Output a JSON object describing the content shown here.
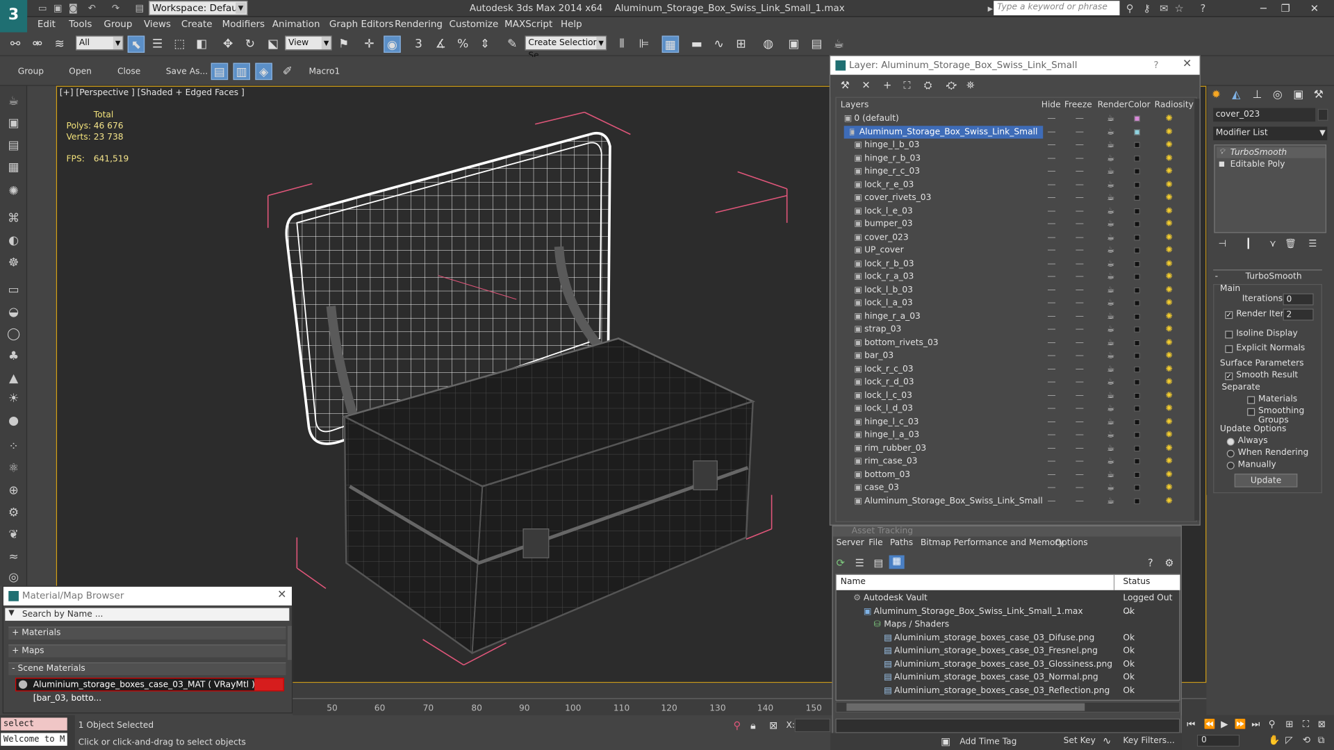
{
  "title": {
    "app": "Autodesk 3ds Max  2014 x64",
    "file": "Aluminum_Storage_Box_Swiss_Link_Small_1.max",
    "workspace": "Workspace: Default",
    "search_placeholder": "Type a keyword or phrase"
  },
  "menu": [
    "Edit",
    "Tools",
    "Group",
    "Views",
    "Create",
    "Modifiers",
    "Animation",
    "Graph Editors",
    "Rendering",
    "Customize",
    "MAXScript",
    "Help"
  ],
  "toolbar": {
    "selection_filter": "All",
    "ref_coord": "View",
    "named_selection": "Create Selection Se",
    "group_labels": [
      "Group",
      "Open",
      "Close",
      "Save As...",
      "Macro1"
    ]
  },
  "viewport": {
    "label": "[+] [Perspective ] [Shaded + Edged Faces ]",
    "stats_header": "Total",
    "polys_label": "Polys:",
    "polys": "46 676",
    "verts_label": "Verts:",
    "verts": "23 738",
    "fps_label": "FPS:",
    "fps": "641,519"
  },
  "material_browser": {
    "title": "Material/Map Browser",
    "search": "Search by Name ...",
    "sections": [
      "+ Materials",
      "+ Maps",
      "- Scene Materials"
    ],
    "material": "Aluminium_storage_boxes_case_03_MAT  ( VRayMtl )  [bar_03, botto..."
  },
  "timeline": {
    "ticks": [
      "50",
      "60",
      "70",
      "80",
      "90",
      "100",
      "110",
      "120",
      "130",
      "140",
      "150"
    ]
  },
  "status": {
    "cmd1": "select $cove:",
    "cmd2": "Welcome to M",
    "selected": "1 Object Selected",
    "hint": "Click or click-and-drag to select objects",
    "x_label": "X:",
    "add_time_tag": "Add Time Tag",
    "set_key": "Set Key",
    "key_filters": "Key Filters...",
    "frame": "0"
  },
  "layers": {
    "title": "Layer: Aluminum_Storage_Box_Swiss_Link_Small",
    "columns": [
      "Layers",
      "Hide",
      "Freeze",
      "Render",
      "Color",
      "Radiosity"
    ],
    "rows": [
      {
        "name": "0 (default)",
        "indent": 1
      },
      {
        "name": "Aluminum_Storage_Box_Swiss_Link_Small",
        "indent": 1,
        "selected": true
      },
      {
        "name": "hinge_l_b_03",
        "indent": 2
      },
      {
        "name": "hinge_r_b_03",
        "indent": 2
      },
      {
        "name": "hinge_r_c_03",
        "indent": 2
      },
      {
        "name": "lock_r_e_03",
        "indent": 2
      },
      {
        "name": "cover_rivets_03",
        "indent": 2
      },
      {
        "name": "lock_l_e_03",
        "indent": 2
      },
      {
        "name": "bumper_03",
        "indent": 2
      },
      {
        "name": "cover_023",
        "indent": 2
      },
      {
        "name": "UP_cover",
        "indent": 2
      },
      {
        "name": "lock_r_b_03",
        "indent": 2
      },
      {
        "name": "lock_r_a_03",
        "indent": 2
      },
      {
        "name": "lock_l_b_03",
        "indent": 2
      },
      {
        "name": "lock_l_a_03",
        "indent": 2
      },
      {
        "name": "hinge_r_a_03",
        "indent": 2
      },
      {
        "name": "strap_03",
        "indent": 2
      },
      {
        "name": "bottom_rivets_03",
        "indent": 2
      },
      {
        "name": "bar_03",
        "indent": 2
      },
      {
        "name": "lock_r_c_03",
        "indent": 2
      },
      {
        "name": "lock_r_d_03",
        "indent": 2
      },
      {
        "name": "lock_l_c_03",
        "indent": 2
      },
      {
        "name": "lock_l_d_03",
        "indent": 2
      },
      {
        "name": "hinge_l_c_03",
        "indent": 2
      },
      {
        "name": "hinge_l_a_03",
        "indent": 2
      },
      {
        "name": "rim_rubber_03",
        "indent": 2
      },
      {
        "name": "rim_case_03",
        "indent": 2
      },
      {
        "name": "bottom_03",
        "indent": 2
      },
      {
        "name": "case_03",
        "indent": 2
      },
      {
        "name": "Aluminum_Storage_Box_Swiss_Link_Small",
        "indent": 2
      }
    ]
  },
  "command_panel": {
    "object_name": "cover_023",
    "modifier_list": "Modifier List",
    "stack": [
      "TurboSmooth",
      "Editable Poly"
    ],
    "rollout": "TurboSmooth",
    "main": "Main",
    "iterations_label": "Iterations:",
    "iterations": "0",
    "render_iters_label": "Render Iters:",
    "render_iters": "2",
    "isoline": "Isoline Display",
    "explicit": "Explicit Normals",
    "surface": "Surface Parameters",
    "smooth_result": "Smooth Result",
    "separate": "Separate",
    "materials": "Materials",
    "smoothing_groups": "Smoothing Groups",
    "update_options": "Update Options",
    "always": "Always",
    "when_rendering": "When Rendering",
    "manually": "Manually",
    "update_btn": "Update"
  },
  "asset_tracking": {
    "title": "Asset Tracking",
    "menu": [
      "Server",
      "File",
      "Paths",
      "Bitmap Performance and Memory",
      "Options"
    ],
    "col_name": "Name",
    "col_status": "Status",
    "rows": [
      {
        "name": "Autodesk Vault",
        "status": "Logged Out ...",
        "indent": 1
      },
      {
        "name": "Aluminum_Storage_Box_Swiss_Link_Small_1.max",
        "status": "Ok",
        "indent": 2
      },
      {
        "name": "Maps / Shaders",
        "status": "",
        "indent": 3
      },
      {
        "name": "Aluminium_storage_boxes_case_03_Difuse.png",
        "status": "Ok",
        "indent": 4
      },
      {
        "name": "Aluminium_storage_boxes_case_03_Fresnel.png",
        "status": "Ok",
        "indent": 4
      },
      {
        "name": "Aluminium_storage_boxes_case_03_Glossiness.png",
        "status": "Ok",
        "indent": 4
      },
      {
        "name": "Aluminium_storage_boxes_case_03_Normal.png",
        "status": "Ok",
        "indent": 4
      },
      {
        "name": "Aluminium_storage_boxes_case_03_Reflection.png",
        "status": "Ok",
        "indent": 4
      }
    ]
  },
  "colors": {
    "accent": "#d4a017",
    "selection": "#3e6cb8",
    "bbox": "#e0567a"
  }
}
